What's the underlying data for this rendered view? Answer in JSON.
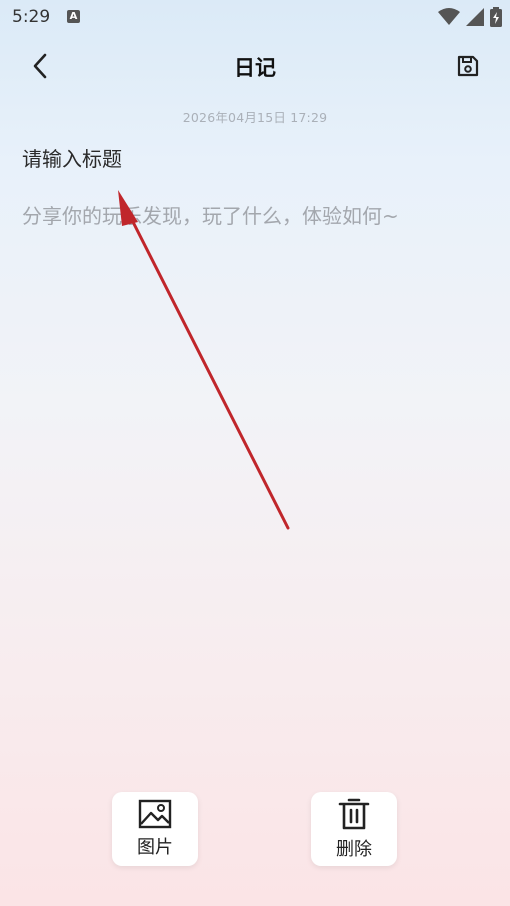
{
  "status_bar": {
    "time": "5:29",
    "notification_icon": "a-icon",
    "icons": [
      "wifi-icon",
      "signal-icon",
      "battery-icon"
    ]
  },
  "header": {
    "back_icon": "chevron-left-icon",
    "title": "日记",
    "save_icon": "save-icon"
  },
  "entry": {
    "datetime": "2026年04月15日  17:29",
    "title_placeholder": "请输入标题",
    "title_value": "",
    "body_placeholder": "分享你的玩乐发现，玩了什么，体验如何~",
    "body_value": ""
  },
  "toolbar": {
    "image_label": "图片",
    "image_icon": "image-icon",
    "delete_label": "删除",
    "delete_icon": "trash-icon"
  },
  "annotation": {
    "color": "#c0262b"
  }
}
